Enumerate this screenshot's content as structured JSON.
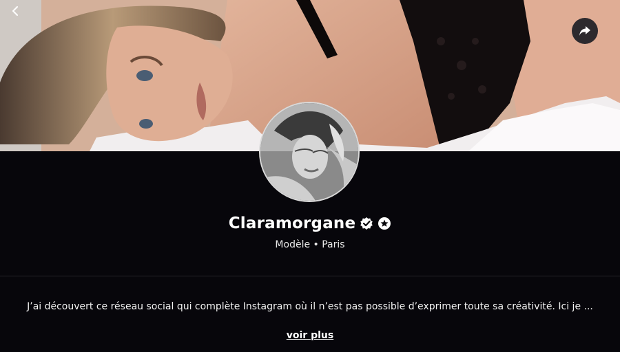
{
  "header": {
    "back_icon": "chevron-left-icon",
    "share_icon": "share-arrow-icon"
  },
  "profile": {
    "name": "Claramorgane",
    "badges": [
      "verified-badge-icon",
      "star-badge-icon"
    ],
    "subtitle": "Modèle • Paris",
    "bio": "J’ai découvert ce réseau social qui complète Instagram où il n’est pas possible d’exprimer toute sa créativité. Ici je ...",
    "more_label": "voir plus"
  },
  "colors": {
    "background": "#07060b",
    "divider": "#27262b",
    "share_button": "#2d2a2e",
    "text": "#ffffff"
  }
}
